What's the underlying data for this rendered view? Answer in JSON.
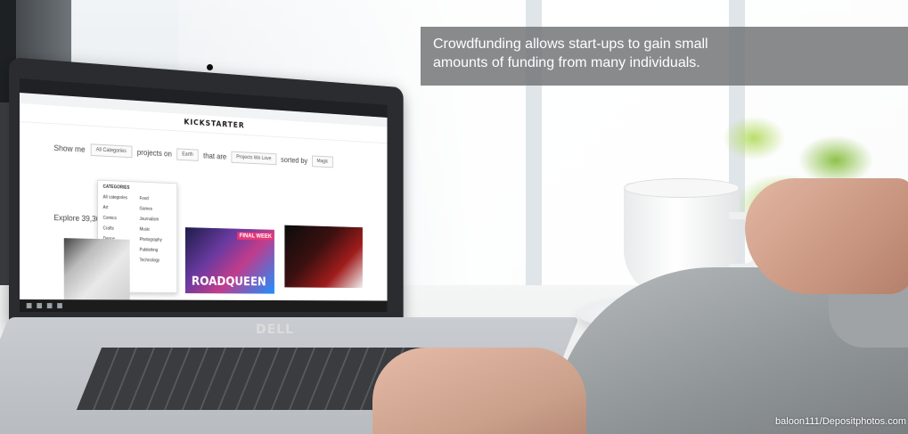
{
  "caption": {
    "line1": "Crowdfunding allows start-ups to gain small",
    "line2": "amounts of funding from many individuals."
  },
  "credit": "baloon111/Depositphotos.com",
  "screen": {
    "site_logo": "KICKSTARTER",
    "filter": {
      "show_me": "Show me",
      "category": "All Categories",
      "projects_on": "projects on",
      "location": "Earth",
      "that_are": "that are",
      "qualifier": "Projects We Love",
      "sorted_by": "sorted by",
      "sort": "Magic"
    },
    "explore": "Explore 39,36",
    "dropdown": {
      "header": "CATEGORIES",
      "items": [
        "All categories",
        "Food",
        "Art",
        "Games",
        "Comics",
        "Journalism",
        "Crafts",
        "Music",
        "Dance",
        "Photography",
        "Design",
        "Publishing",
        "Fashion",
        "Technology"
      ]
    },
    "card2_title": "ROADQUEEN",
    "card2_badge": "FINAL WEEK"
  },
  "laptop_brand": "DELL"
}
